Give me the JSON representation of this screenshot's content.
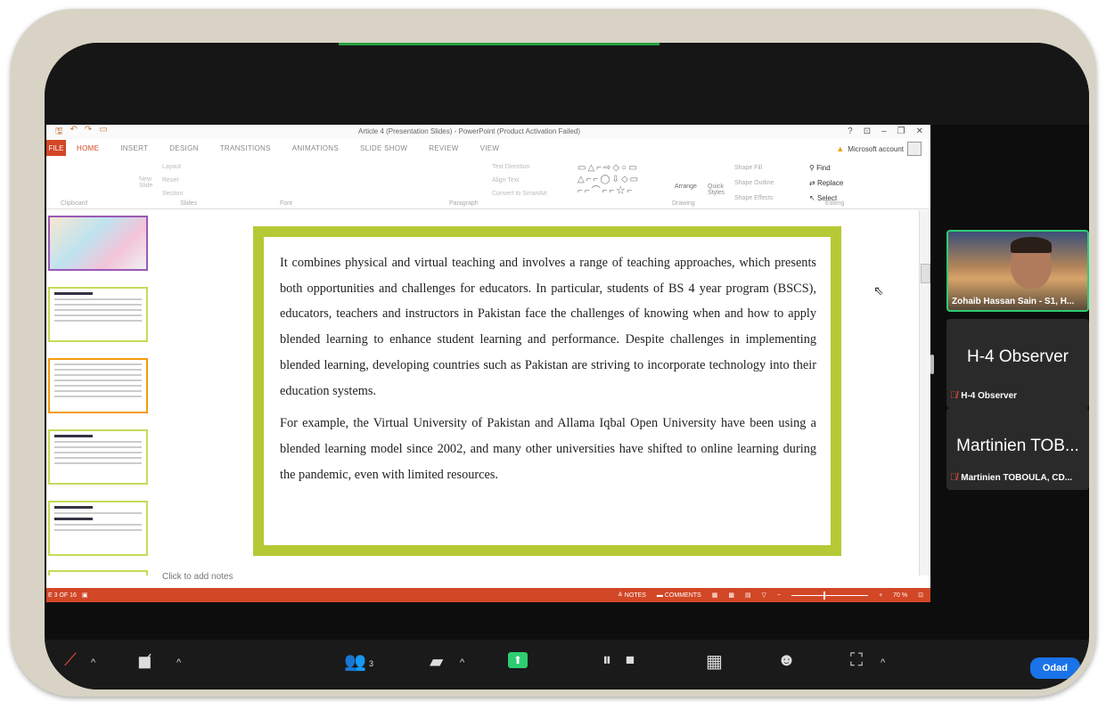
{
  "ppt": {
    "title": "Article 4 (Presentation Slides) - PowerPoint (Product Activation Failed)",
    "window_controls": [
      "?",
      "⊡",
      "–",
      "❐",
      "✕"
    ],
    "tabs": [
      "FILE",
      "HOME",
      "INSERT",
      "DESIGN",
      "TRANSITIONS",
      "ANIMATIONS",
      "SLIDE SHOW",
      "REVIEW",
      "VIEW"
    ],
    "account": "Microsoft account",
    "ribbon": {
      "layout": "Layout",
      "reset": "Reset",
      "section": "Section",
      "new_slide": "New Slide",
      "text_direction": "Text Direction",
      "align_text": "Align Text",
      "convert_smartart": "Convert to SmartArt",
      "arrange": "Arrange",
      "quick_styles": "Quick Styles",
      "shape_fill": "Shape Fill",
      "shape_outline": "Shape Outline",
      "shape_effects": "Shape Effects",
      "find": "Find",
      "replace": "Replace",
      "select": "Select",
      "groups": [
        "Clipboard",
        "Slides",
        "Font",
        "Paragraph",
        "Drawing",
        "Editing"
      ]
    },
    "slide": {
      "paragraph1": "It combines physical and virtual teaching and involves a range of teaching approaches, which presents both opportunities and challenges for educators. In particular, students of BS 4 year program (BSCS), educators, teachers and instructors in Pakistan face the challenges of knowing when and how to apply blended learning to enhance student learning and performance. Despite challenges in implementing blended learning, developing countries such as Pakistan are striving to incorporate technology into their education systems.",
      "paragraph2": "For example, the Virtual University of Pakistan and Allama Iqbal Open University have been using a blended learning model since 2002, and many other universities have shifted to online learning during the pandemic, even with limited resources."
    },
    "notes_placeholder": "Click to add notes",
    "status": {
      "slide_number": "E 3 OF 16",
      "notes": "NOTES",
      "comments": "COMMENTS",
      "zoom": "70 %"
    }
  },
  "participants": {
    "video_name": "Zohaib Hassan Sain - S1, H...",
    "observer_big": "H-4 Observer",
    "observer_small": "H-4 Observer",
    "martinien_big": "Martinien TOB...",
    "martinien_small": "Martinien TOBOULA, CD..."
  },
  "toolbar": {
    "participants_count": "3",
    "oda": "Odad"
  },
  "colors": {
    "accent": "#d24726",
    "slide_border": "#b5c934",
    "share_green": "#2ecc71"
  }
}
